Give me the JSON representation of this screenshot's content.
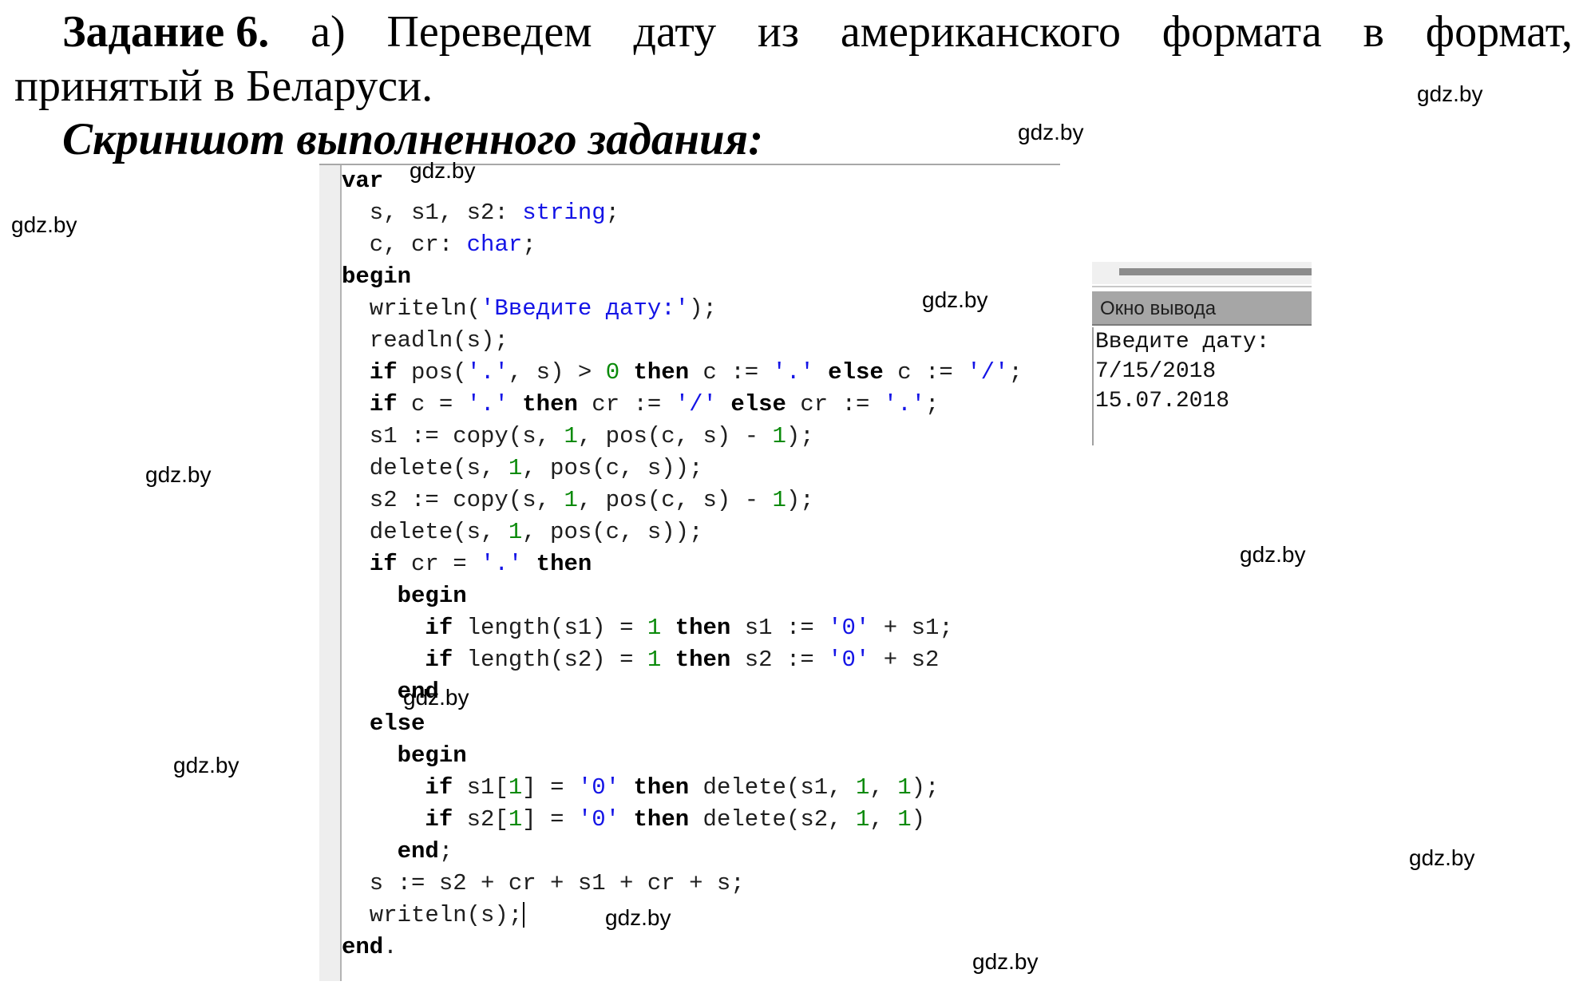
{
  "heading": {
    "task_label": "Задание 6.",
    "line1_words": [
      "а)",
      "Переведем",
      "дату",
      "из",
      "американского",
      "формата",
      "в",
      "формат,"
    ],
    "line2": "принятый в Беларуси.",
    "screenshot_caption": "Скриншот выполненного задания:"
  },
  "editor": {
    "lines": [
      [
        {
          "t": "var",
          "c": "kw"
        }
      ],
      [
        {
          "t": "  s, s1, s2: "
        },
        {
          "t": "string",
          "c": "typ"
        },
        {
          "t": ";"
        }
      ],
      [
        {
          "t": "  c, cr: "
        },
        {
          "t": "char",
          "c": "typ"
        },
        {
          "t": ";"
        }
      ],
      [
        {
          "t": "begin",
          "c": "kw"
        }
      ],
      [
        {
          "t": "  writeln("
        },
        {
          "t": "'Введите дату:'",
          "c": "str"
        },
        {
          "t": ");"
        }
      ],
      [
        {
          "t": "  readln(s);"
        }
      ],
      [
        {
          "t": "  "
        },
        {
          "t": "if",
          "c": "kw"
        },
        {
          "t": " pos("
        },
        {
          "t": "'.'",
          "c": "str"
        },
        {
          "t": ", s) > "
        },
        {
          "t": "0",
          "c": "num"
        },
        {
          "t": " "
        },
        {
          "t": "then",
          "c": "kw"
        },
        {
          "t": " c := "
        },
        {
          "t": "'.'",
          "c": "str"
        },
        {
          "t": " "
        },
        {
          "t": "else",
          "c": "kw"
        },
        {
          "t": " c := "
        },
        {
          "t": "'/'",
          "c": "str"
        },
        {
          "t": ";"
        }
      ],
      [
        {
          "t": "  "
        },
        {
          "t": "if",
          "c": "kw"
        },
        {
          "t": " c = "
        },
        {
          "t": "'.'",
          "c": "str"
        },
        {
          "t": " "
        },
        {
          "t": "then",
          "c": "kw"
        },
        {
          "t": " cr := "
        },
        {
          "t": "'/'",
          "c": "str"
        },
        {
          "t": " "
        },
        {
          "t": "else",
          "c": "kw"
        },
        {
          "t": " cr := "
        },
        {
          "t": "'.'",
          "c": "str"
        },
        {
          "t": ";"
        }
      ],
      [
        {
          "t": "  s1 := copy(s, "
        },
        {
          "t": "1",
          "c": "num"
        },
        {
          "t": ", pos(c, s) - "
        },
        {
          "t": "1",
          "c": "num"
        },
        {
          "t": ");"
        }
      ],
      [
        {
          "t": "  delete(s, "
        },
        {
          "t": "1",
          "c": "num"
        },
        {
          "t": ", pos(c, s));"
        }
      ],
      [
        {
          "t": "  s2 := copy(s, "
        },
        {
          "t": "1",
          "c": "num"
        },
        {
          "t": ", pos(c, s) - "
        },
        {
          "t": "1",
          "c": "num"
        },
        {
          "t": ");"
        }
      ],
      [
        {
          "t": "  delete(s, "
        },
        {
          "t": "1",
          "c": "num"
        },
        {
          "t": ", pos(c, s));"
        }
      ],
      [
        {
          "t": "  "
        },
        {
          "t": "if",
          "c": "kw"
        },
        {
          "t": " cr = "
        },
        {
          "t": "'.'",
          "c": "str"
        },
        {
          "t": " "
        },
        {
          "t": "then",
          "c": "kw"
        }
      ],
      [
        {
          "t": "    "
        },
        {
          "t": "begin",
          "c": "kw"
        }
      ],
      [
        {
          "t": "      "
        },
        {
          "t": "if",
          "c": "kw"
        },
        {
          "t": " length(s1) = "
        },
        {
          "t": "1",
          "c": "num"
        },
        {
          "t": " "
        },
        {
          "t": "then",
          "c": "kw"
        },
        {
          "t": " s1 := "
        },
        {
          "t": "'0'",
          "c": "str"
        },
        {
          "t": " + s1;"
        }
      ],
      [
        {
          "t": "      "
        },
        {
          "t": "if",
          "c": "kw"
        },
        {
          "t": " length(s2) = "
        },
        {
          "t": "1",
          "c": "num"
        },
        {
          "t": " "
        },
        {
          "t": "then",
          "c": "kw"
        },
        {
          "t": " s2 := "
        },
        {
          "t": "'0'",
          "c": "str"
        },
        {
          "t": " + s2"
        }
      ],
      [
        {
          "t": "    "
        },
        {
          "t": "end",
          "c": "kw"
        }
      ],
      [
        {
          "t": "  "
        },
        {
          "t": "else",
          "c": "kw"
        }
      ],
      [
        {
          "t": "    "
        },
        {
          "t": "begin",
          "c": "kw"
        }
      ],
      [
        {
          "t": "      "
        },
        {
          "t": "if",
          "c": "kw"
        },
        {
          "t": " s1["
        },
        {
          "t": "1",
          "c": "num"
        },
        {
          "t": "] = "
        },
        {
          "t": "'0'",
          "c": "str"
        },
        {
          "t": " "
        },
        {
          "t": "then",
          "c": "kw"
        },
        {
          "t": " delete(s1, "
        },
        {
          "t": "1",
          "c": "num"
        },
        {
          "t": ", "
        },
        {
          "t": "1",
          "c": "num"
        },
        {
          "t": ");"
        }
      ],
      [
        {
          "t": "      "
        },
        {
          "t": "if",
          "c": "kw"
        },
        {
          "t": " s2["
        },
        {
          "t": "1",
          "c": "num"
        },
        {
          "t": "] = "
        },
        {
          "t": "'0'",
          "c": "str"
        },
        {
          "t": " "
        },
        {
          "t": "then",
          "c": "kw"
        },
        {
          "t": " delete(s2, "
        },
        {
          "t": "1",
          "c": "num"
        },
        {
          "t": ", "
        },
        {
          "t": "1",
          "c": "num"
        },
        {
          "t": ")"
        }
      ],
      [
        {
          "t": "    "
        },
        {
          "t": "end",
          "c": "kw"
        },
        {
          "t": ";"
        }
      ],
      [
        {
          "t": "  s := s2 + cr + s1 + cr + s;"
        }
      ],
      [
        {
          "t": "  writeln(s);"
        },
        {
          "cursor": true
        }
      ],
      [
        {
          "t": "end",
          "c": "kw"
        },
        {
          "t": "."
        }
      ]
    ]
  },
  "output_window": {
    "title": "Окно вывода",
    "lines": [
      "Введите дату:",
      "7/15/2018",
      "15.07.2018"
    ]
  },
  "watermarks": [
    "gdz.by",
    "gdz.by",
    "gdz.by",
    "gdz.by",
    "gdz.by",
    "gdz.by",
    "gdz.by",
    "gdz.by",
    "gdz.by",
    "gdz.by",
    "gdz.by",
    "gdz.by"
  ],
  "colors": {
    "keyword": "#000000",
    "string": "#1414e6",
    "number": "#0a8a0a",
    "type": "#1414e6",
    "output_header_bg": "#a6a6a6",
    "gutter_bg": "#eeeeee"
  }
}
